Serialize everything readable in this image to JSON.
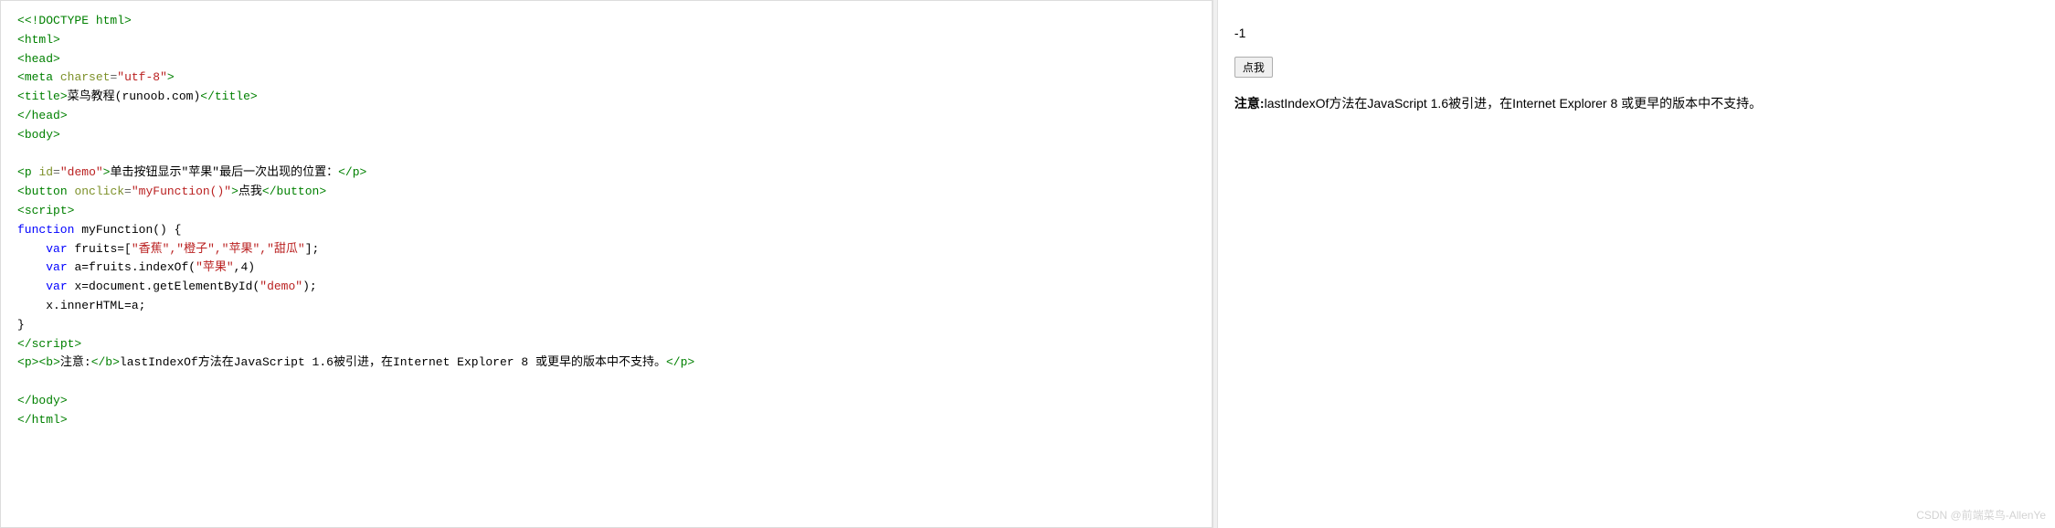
{
  "code": {
    "doctype": "<!DOCTYPE html>",
    "html_open": "html",
    "head_open": "head",
    "meta_tag": "meta",
    "meta_attr": "charset",
    "meta_val": "\"utf-8\"",
    "title_open": "title",
    "title_text": "菜鸟教程(runoob.com)",
    "title_close": "/title",
    "head_close": "/head",
    "body_open": "body",
    "p_tag": "p",
    "p_attr": "id",
    "p_val": "\"demo\"",
    "p_text": "单击按钮显示\"苹果\"最后一次出现的位置：",
    "p_close": "/p",
    "button_open": "button",
    "button_attr": "onclick",
    "button_val": "\"myFunction()\"",
    "button_text": "点我",
    "button_close": "/button",
    "script_open": "script",
    "func_kw": "function",
    "func_name": "myFunction",
    "func_parens": "() {",
    "var1_kw": "var",
    "var1_name": "fruits=[",
    "var1_vals": "\"香蕉\",\"橙子\",\"苹果\",\"甜瓜\"",
    "var1_end": "];",
    "var2_kw": "var",
    "var2_name": "a=fruits.indexOf(",
    "var2_arg": "\"苹果\"",
    "var2_end": ",4)",
    "var3_kw": "var",
    "var3_name": "x=document.getElementById(",
    "var3_arg": "\"demo\"",
    "var3_end": ");",
    "line_inner": "x.innerHTML=a;",
    "brace_close": "}",
    "script_close": "/script",
    "p2_open": "p",
    "b_open": "b",
    "b_text": "注意:",
    "b_close": "/b",
    "note_text": "lastIndexOf方法在JavaScript 1.6被引进，在Internet Explorer 8 或更早的版本中不支持。",
    "p2_close": "/p",
    "body_close": "/body",
    "html_close": "/html"
  },
  "output": {
    "demo_text": "-1",
    "button_label": "点我",
    "note_bold": "注意:",
    "note_rest": "lastIndexOf方法在JavaScript 1.6被引进，在Internet Explorer 8 或更早的版本中不支持。"
  },
  "watermark": "CSDN @前端菜鸟-AllenYe"
}
